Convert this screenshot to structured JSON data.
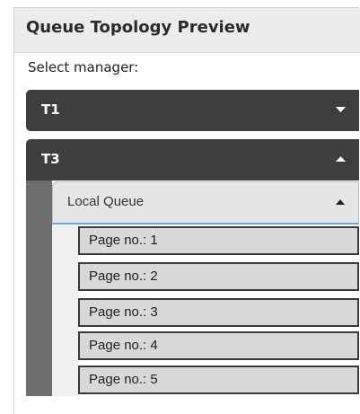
{
  "panel": {
    "title": "Queue Topology Preview",
    "select_label": "Select manager:"
  },
  "managers": [
    {
      "label": "T1",
      "state": "collapsed",
      "caret_icon": "caret-down-icon"
    },
    {
      "label": "T3",
      "state": "expanded",
      "caret_icon": "caret-up-icon"
    }
  ],
  "local_queue": {
    "label": "Local Queue",
    "state": "expanded",
    "caret_icon": "caret-up-icon"
  },
  "pages": [
    {
      "label": "Page no.: 1"
    },
    {
      "label": "Page no.: 2"
    },
    {
      "label": "Page no.: 3"
    },
    {
      "label": "Page no.: 4"
    },
    {
      "label": "Page no.: 5"
    }
  ],
  "colors": {
    "manager_bg": "#3e3e3e",
    "header_bg": "#ececec",
    "page_bg": "#d8d8d8",
    "accent": "#6aa6d8"
  }
}
